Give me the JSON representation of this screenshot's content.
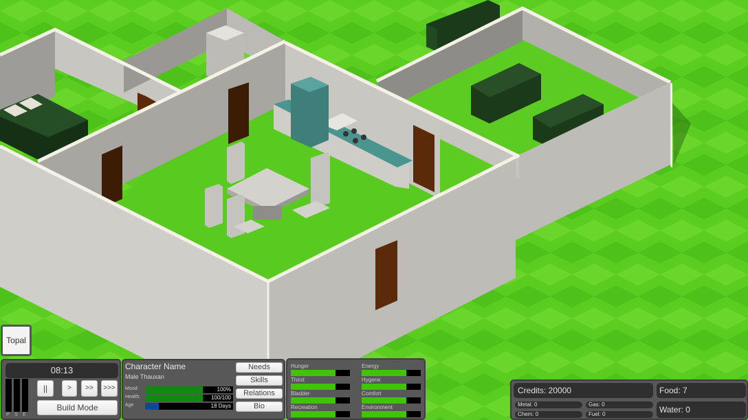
{
  "game": {
    "character_tab": "Topal",
    "time": "08:13",
    "speed_meters": [
      {
        "label": "P",
        "level": 0
      },
      {
        "label": "S",
        "level": 0
      },
      {
        "label": "E",
        "level": 0
      }
    ],
    "speed_buttons": {
      "pause": "||",
      "normal": ">",
      "fast": ">>",
      "fastest": ">>>"
    },
    "build_mode_label": "Build Mode"
  },
  "character": {
    "name": "Character Name",
    "description": "Male Thauxan",
    "stats": [
      {
        "label": "Mood:",
        "value": "100%",
        "fill": 0.66,
        "color": "#0f8a0f"
      },
      {
        "label": "Health:",
        "value": "100/100",
        "fill": 0.66,
        "color": "#0f8a0f"
      },
      {
        "label": "Age",
        "value": "18 Days",
        "fill": 0.16,
        "color": "#0a4a9a"
      }
    ],
    "tabs": [
      "Needs",
      "Skills",
      "Relations",
      "Bio"
    ]
  },
  "needs": {
    "left": [
      {
        "label": "Hunger",
        "fill": 0.75
      },
      {
        "label": "Thirst",
        "fill": 0.75
      },
      {
        "label": "Bladder",
        "fill": 0.75
      },
      {
        "label": "Recreation",
        "fill": 0.75
      }
    ],
    "right": [
      {
        "label": "Energy",
        "fill": 0.75
      },
      {
        "label": "Hygene",
        "fill": 0.75
      },
      {
        "label": "Comfort",
        "fill": 0.75
      },
      {
        "label": "Environment",
        "fill": 0.75
      }
    ],
    "fill_color": "#3fc40a"
  },
  "resources": {
    "credits": "Credits: 20000",
    "food": "Food: 7",
    "water": "Water: 0",
    "metal": "Metal: 0",
    "gas": "Gas: 0",
    "chem": "Chem: 0",
    "fuel": "Fuel: 0"
  },
  "colors": {
    "grass_light": "#6cd425",
    "grass_dark": "#4cc21a",
    "wall": "#c9c7c2",
    "door": "#5a2a0a",
    "furniture_green": "#204a20",
    "kitchen_teal": "#4a9590"
  }
}
